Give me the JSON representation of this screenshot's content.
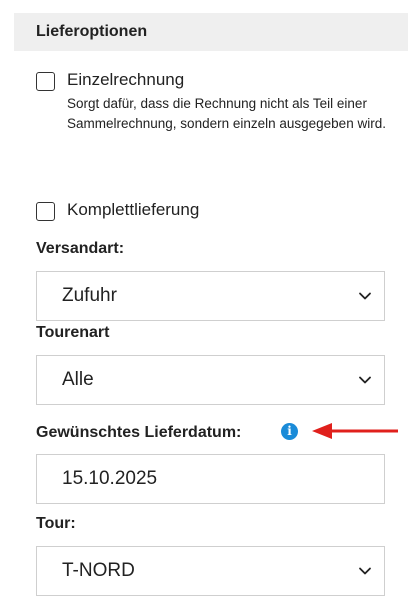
{
  "section": {
    "title": "Lieferoptionen"
  },
  "options": {
    "einzelrechnung": {
      "label": "Einzelrechnung",
      "description": "Sorgt dafür, dass die Rechnung nicht als Teil einer Sammelrechnung, sondern einzeln ausgegeben wird.",
      "checked": false
    },
    "komplettlieferung": {
      "label": "Komplettlieferung",
      "checked": false
    }
  },
  "versandart": {
    "label": "Versandart:",
    "value": "Zufuhr"
  },
  "tourenart": {
    "label": "Tourenart",
    "value": "Alle"
  },
  "lieferdatum": {
    "label": "Gewünschtes Lieferdatum:",
    "value": "15.10.2025",
    "info_icon": "info-icon"
  },
  "tour": {
    "label": "Tour:",
    "value": "T-NORD"
  },
  "colors": {
    "header_bg": "#efefef",
    "info_blue": "#1a8bd8",
    "annotation_arrow": "#e0201c"
  }
}
